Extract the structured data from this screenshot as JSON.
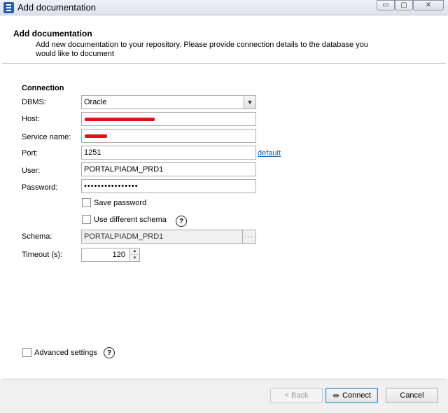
{
  "window": {
    "title": "Add documentation",
    "controls": {
      "minimize": "▭",
      "maximize": "▢",
      "close": "✕"
    }
  },
  "header": {
    "title": "Add documentation",
    "description": "Add new documentation to your repository. Please provide connection details to the database you would like to document"
  },
  "form": {
    "section_title": "Connection",
    "dbms": {
      "label": "DBMS:",
      "value": "Oracle"
    },
    "host": {
      "label": "Host:",
      "value": ""
    },
    "service_name": {
      "label": "Service name:",
      "value": ""
    },
    "port": {
      "label": "Port:",
      "value": "1251",
      "default_link": "default"
    },
    "user": {
      "label": "User:",
      "value": "PORTALPIADM_PRD1"
    },
    "password": {
      "label": "Password:",
      "value": "••••••••••••••••"
    },
    "save_password": {
      "label": "Save password",
      "checked": false
    },
    "use_different_schema": {
      "label": "Use different schema",
      "checked": false,
      "help": "?"
    },
    "schema": {
      "label": "Schema:",
      "value": "PORTALPIADM_PRD1",
      "button": "···"
    },
    "timeout": {
      "label": "Timeout (s):",
      "value": "120"
    }
  },
  "advanced": {
    "label": "Advanced settings",
    "checked": false,
    "help": "?"
  },
  "footer": {
    "back_label": "< Back",
    "connect_label": "Connect",
    "cancel_label": "Cancel"
  },
  "colors": {
    "accent": "#2a5fa8",
    "link": "#0b63b5",
    "redaction": "#e3111e"
  }
}
